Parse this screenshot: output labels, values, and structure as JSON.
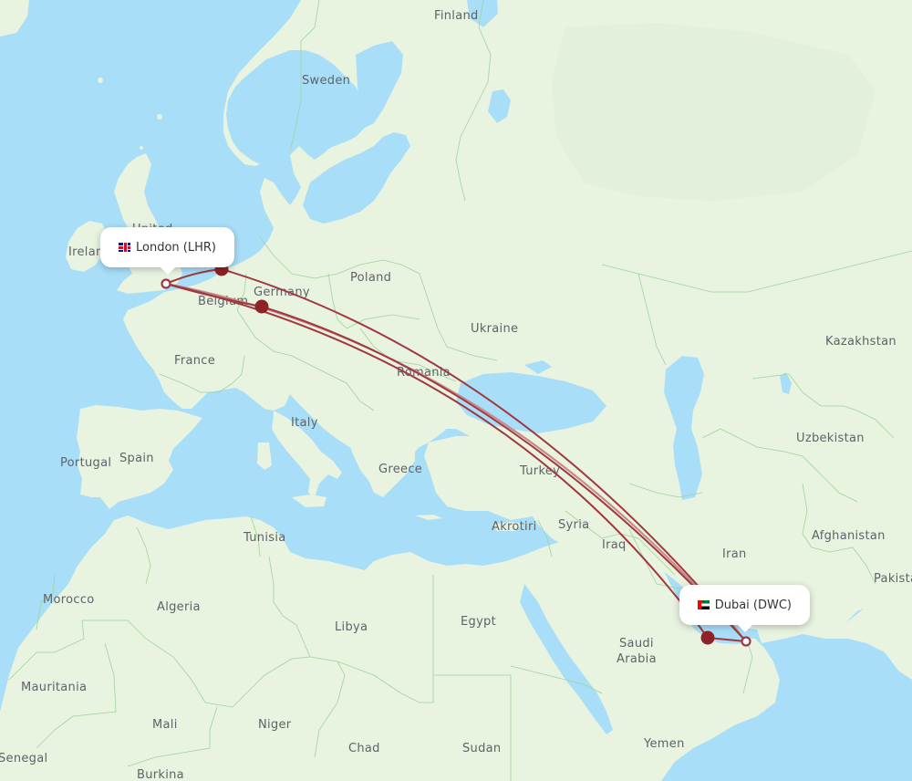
{
  "map": {
    "colors": {
      "water": "#a9def9",
      "land": "#e8f3e0",
      "land_dark": "#dcecd2",
      "border": "#9fd49a",
      "route": "#a0393f",
      "route_light": "#c9898c",
      "stop_marker": "#8f2128"
    },
    "country_labels": [
      {
        "name": "Finland"
      },
      {
        "name": "Sweden"
      },
      {
        "name": "United"
      },
      {
        "name": "Ireland"
      },
      {
        "name": "Poland"
      },
      {
        "name": "Germany"
      },
      {
        "name": "Belgium"
      },
      {
        "name": "Ukraine"
      },
      {
        "name": "France"
      },
      {
        "name": "Kazakhstan"
      },
      {
        "name": "Romania"
      },
      {
        "name": "Italy"
      },
      {
        "name": "Uzbekistan"
      },
      {
        "name": "Portugal"
      },
      {
        "name": "Spain"
      },
      {
        "name": "Greece"
      },
      {
        "name": "Turkey"
      },
      {
        "name": "Akrotiri"
      },
      {
        "name": "Syria"
      },
      {
        "name": "Tunisia"
      },
      {
        "name": "Afghanistan"
      },
      {
        "name": "Iraq"
      },
      {
        "name": "Iran"
      },
      {
        "name": "Pakistan"
      },
      {
        "name": "Morocco"
      },
      {
        "name": "Algeria"
      },
      {
        "name": "Libya"
      },
      {
        "name": "Egypt"
      },
      {
        "name": "Saudi"
      },
      {
        "name": "Arabia"
      },
      {
        "name": "Mauritania"
      },
      {
        "name": "Mali"
      },
      {
        "name": "Niger"
      },
      {
        "name": "Chad"
      },
      {
        "name": "Sudan"
      },
      {
        "name": "Yemen"
      },
      {
        "name": "Senegal"
      },
      {
        "name": "Burkina"
      }
    ],
    "origin": {
      "city": "London",
      "code": "LHR",
      "label": "London (LHR)",
      "flag": "uk-flag"
    },
    "destination": {
      "city": "Dubai",
      "code": "DWC",
      "label": "Dubai (DWC)",
      "flag": "uae-flag"
    },
    "stopovers": [
      {
        "name": "stop-netherlands"
      },
      {
        "name": "stop-germany"
      },
      {
        "name": "stop-gulf"
      }
    ],
    "routes_count": 4
  }
}
